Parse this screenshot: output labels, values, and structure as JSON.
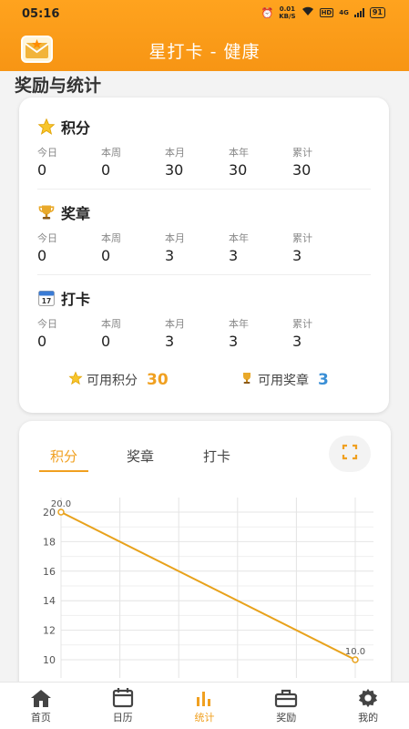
{
  "status_bar": {
    "time": "05:16",
    "net_speed_top": "0.01",
    "net_speed_bottom": "KB/S",
    "hd": "HD",
    "network": "4G",
    "battery": "91"
  },
  "header": {
    "title": "星打卡 - 健康"
  },
  "section": {
    "title": "奖励与统计"
  },
  "groups": [
    {
      "title": "积分",
      "icon": "star-icon",
      "labels": [
        "今日",
        "本周",
        "本月",
        "本年",
        "累计"
      ],
      "values": [
        "0",
        "0",
        "30",
        "30",
        "30"
      ]
    },
    {
      "title": "奖章",
      "icon": "trophy-icon",
      "labels": [
        "今日",
        "本周",
        "本月",
        "本年",
        "累计"
      ],
      "values": [
        "0",
        "0",
        "3",
        "3",
        "3"
      ]
    },
    {
      "title": "打卡",
      "icon": "calendar-icon",
      "labels": [
        "今日",
        "本周",
        "本月",
        "本年",
        "累计"
      ],
      "values": [
        "0",
        "0",
        "3",
        "3",
        "3"
      ]
    }
  ],
  "available": {
    "points_label": "可用积分",
    "points_value": "30",
    "medals_label": "可用奖章",
    "medals_value": "3"
  },
  "tabs": [
    "积分",
    "奖章",
    "打卡"
  ],
  "active_tab": 0,
  "chart_data": {
    "type": "line",
    "x": [
      0,
      5
    ],
    "series": [
      {
        "values": [
          20.0,
          10.0
        ],
        "point_labels": [
          "20.0",
          "10.0"
        ]
      }
    ],
    "ylim": [
      10,
      20
    ],
    "yticks": [
      "20",
      "18",
      "16",
      "14",
      "12",
      "10"
    ],
    "grid": true,
    "color": "#e8a21c"
  },
  "bottom_nav": [
    {
      "label": "首页",
      "icon": "home-icon"
    },
    {
      "label": "日历",
      "icon": "calendar-icon"
    },
    {
      "label": "统计",
      "icon": "bar-chart-icon"
    },
    {
      "label": "奖励",
      "icon": "gift-icon"
    },
    {
      "label": "我的",
      "icon": "gear-icon"
    }
  ],
  "colors": {
    "accent": "#f0a020",
    "header": "#f79a17",
    "medal_value": "#3a8fd6"
  }
}
